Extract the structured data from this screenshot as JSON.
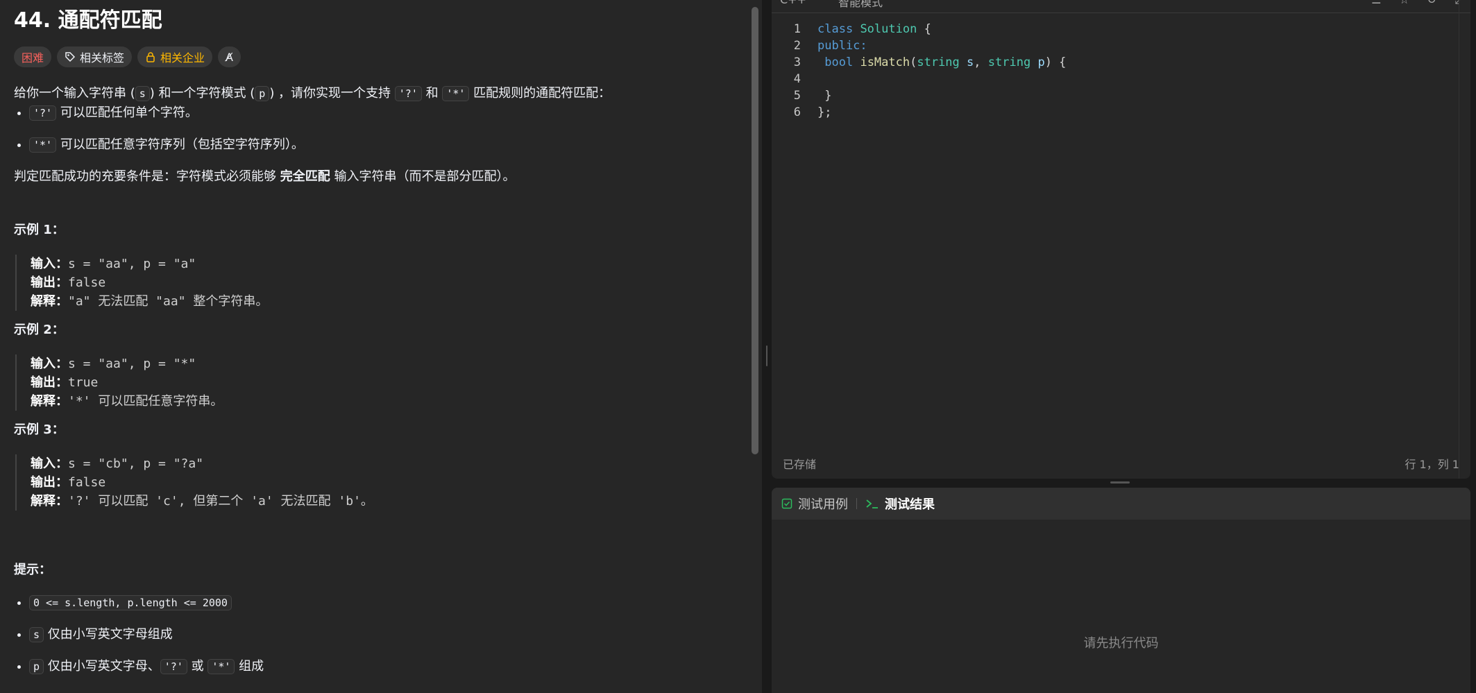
{
  "problem": {
    "title": "44. 通配符匹配",
    "tags": [
      "困难",
      "相关标签",
      "相关企业",
      "A̸"
    ],
    "desc_line1_a": "给你一个输入字符串 (",
    "desc_s": "s",
    "desc_line1_b": ") 和一个字符模式 (",
    "desc_p": "p",
    "desc_line1_c": ") ，请你实现一个支持 ",
    "desc_q": "'?'",
    "desc_and": " 和 ",
    "desc_star": "'*'",
    "desc_line1_d": " 匹配规则的通配符匹配：",
    "bullet1_code": "'?'",
    "bullet1_text": " 可以匹配任何单个字符。",
    "bullet2_code": "'*'",
    "bullet2_text": " 可以匹配任意字符序列（包括空字符序列）。",
    "cond_a": "判定匹配成功的充要条件是：字符模式必须能够 ",
    "cond_bold": "完全匹配",
    "cond_b": " 输入字符串（而不是部分匹配）。",
    "examples": [
      {
        "title": "示例 1：",
        "in_label": "输入：",
        "in": "s = \"aa\", p = \"a\"",
        "out_label": "输出：",
        "out": "false",
        "ex_label": "解释：",
        "ex": "\"a\" 无法匹配 \"aa\" 整个字符串。"
      },
      {
        "title": "示例 2：",
        "in_label": "输入：",
        "in": "s = \"aa\", p = \"*\"",
        "out_label": "输出：",
        "out": "true",
        "ex_label": "解释：",
        "ex": "'*' 可以匹配任意字符串。"
      },
      {
        "title": "示例 3：",
        "in_label": "输入：",
        "in": "s = \"cb\", p = \"?a\"",
        "out_label": "输出：",
        "out": "false",
        "ex_label": "解释：",
        "ex": "'?' 可以匹配 'c', 但第二个 'a' 无法匹配 'b'。"
      }
    ],
    "hints_title": "提示：",
    "hint1_code": "0 <= s.length, p.length <= 2000",
    "hint2_code": "s",
    "hint2_text": " 仅由小写英文字母组成",
    "hint3_code": "p",
    "hint3_text": " 仅由小写英文字母、",
    "hint3_q": "'?'",
    "hint3_or": " 或 ",
    "hint3_star": "'*'",
    "hint3_tail": " 组成"
  },
  "editor": {
    "lang": "C++",
    "mode": "智能模式",
    "lines": [
      "1",
      "2",
      "3",
      "4",
      "5",
      "6"
    ],
    "status": "已存储",
    "position": "行 1，列 1"
  },
  "testpanel": {
    "tab_cases": "测试用例",
    "tab_result": "测试结果",
    "empty": "请先执行代码"
  },
  "colors": {
    "hard": "#f8615c",
    "company": "#ffb800",
    "check": "#2cbb5d"
  }
}
